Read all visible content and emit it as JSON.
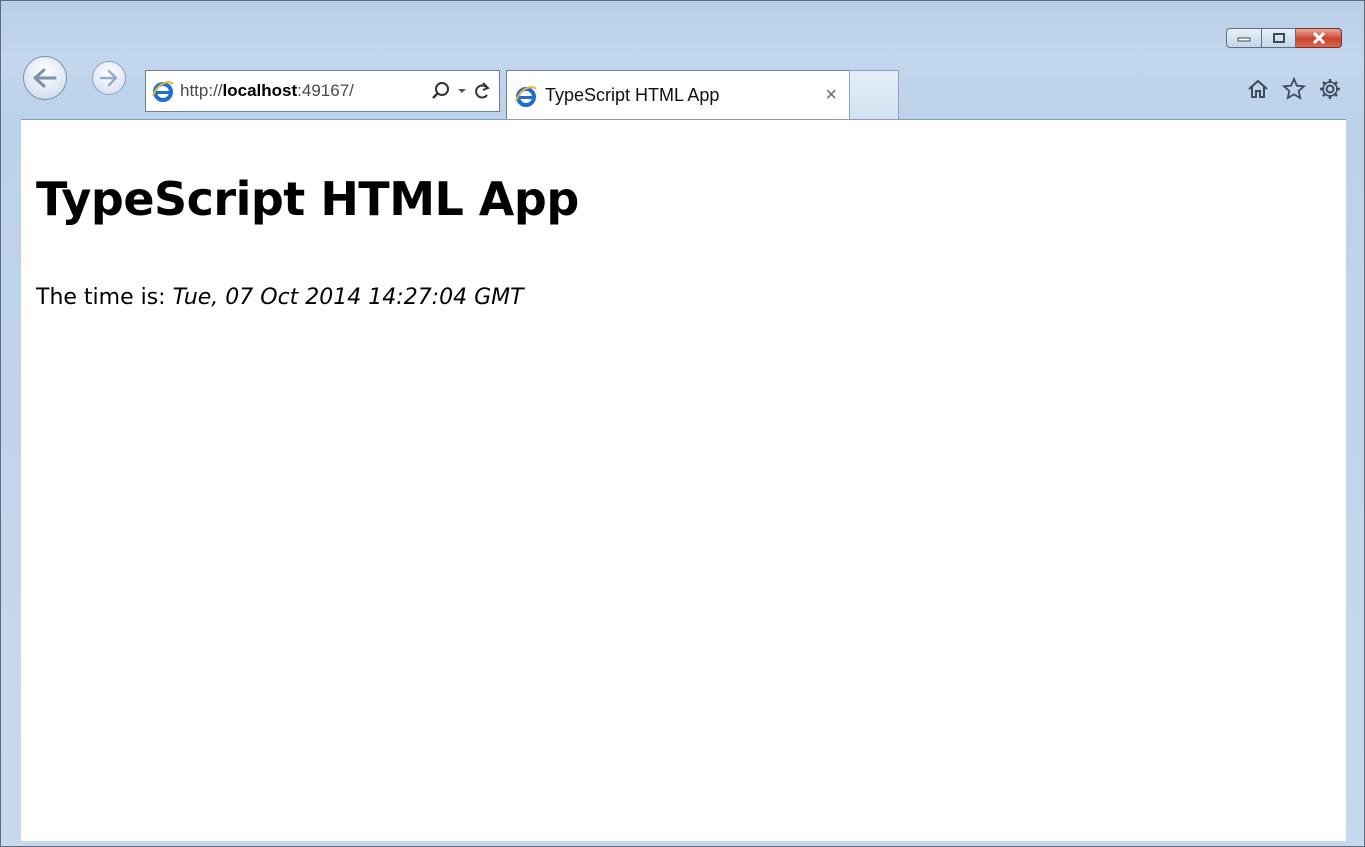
{
  "browser": {
    "address_prefix": "http://",
    "address_host": "localhost",
    "address_rest": ":49167/",
    "tab_title": "TypeScript HTML App",
    "tab_close": "×",
    "icons": [
      "back-arrow-icon",
      "forward-arrow-icon",
      "ie-logo-icon",
      "search-icon",
      "dropdown-icon",
      "refresh-icon",
      "home-icon",
      "favorites-star-icon",
      "gear-icon",
      "minimize-icon",
      "maximize-icon",
      "close-icon"
    ]
  },
  "page": {
    "heading": "TypeScript HTML App",
    "time_label": "The time is: ",
    "time_value": "Tue, 07 Oct 2014 14:27:04 GMT"
  },
  "colors": {
    "frame": "#c2d6ed",
    "close_button": "#c8452f",
    "ie_blue": "#1e6fd0"
  }
}
